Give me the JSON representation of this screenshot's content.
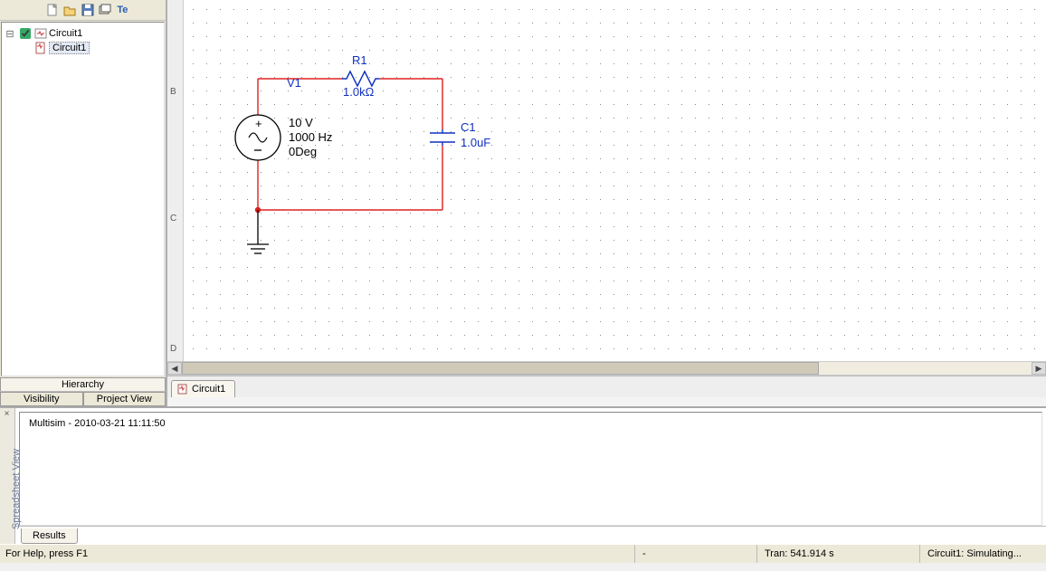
{
  "sidebar": {
    "tree": {
      "root": "Circuit1",
      "child": "Circuit1"
    },
    "tab_hierarchy": "Hierarchy",
    "tab_visibility": "Visibility",
    "tab_project_view": "Project View"
  },
  "ruler": {
    "b": "B",
    "c": "C",
    "d": "D"
  },
  "circuit": {
    "v1": {
      "name": "V1",
      "voltage": "10 V",
      "freq": "1000 Hz",
      "phase": "0Deg"
    },
    "r1": {
      "name": "R1",
      "value": "1.0kΩ"
    },
    "c1": {
      "name": "C1",
      "value": "1.0uF"
    }
  },
  "doc_tab": "Circuit1",
  "spreadsheet": {
    "side_label": "Spreadsheet View",
    "content": "Multisim  -  2010-03-21 11:11:50",
    "results_tab": "Results"
  },
  "status": {
    "help": "For Help, press F1",
    "dash": "-",
    "tran": "Tran: 541.914 s",
    "sim": "Circuit1: Simulating..."
  }
}
